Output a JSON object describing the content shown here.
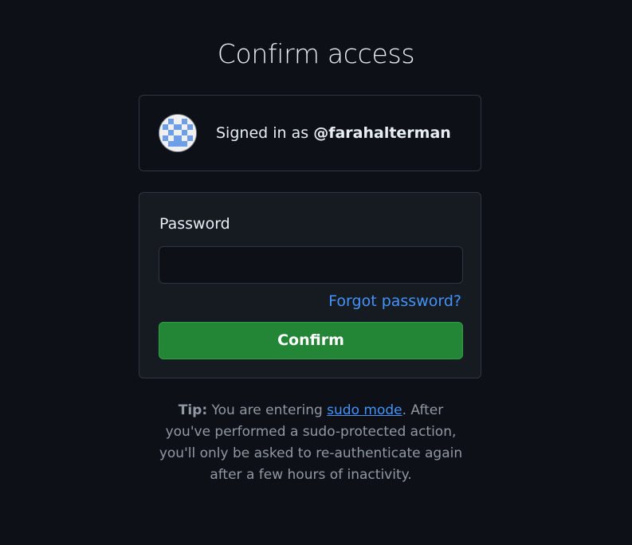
{
  "page": {
    "title": "Confirm access"
  },
  "account": {
    "signed_in_prefix": "Signed in as ",
    "username": "@farahalterman",
    "avatar_icon": "identicon-avatar"
  },
  "form": {
    "password_label": "Password",
    "password_value": "",
    "forgot_password_link": "Forgot password?",
    "confirm_button": "Confirm"
  },
  "tip": {
    "label": "Tip:",
    "text_before_link": " You are entering ",
    "link_text": "sudo mode",
    "text_after_link": ". After you've performed a sudo-protected action, you'll only be asked to re-authenticate again after a few hours of inactivity."
  },
  "colors": {
    "background": "#0d1117",
    "panel": "#161b22",
    "border": "#30363d",
    "accent_link": "#4493f8",
    "button_green": "#238636",
    "avatar_blue": "#6f9ee8"
  }
}
